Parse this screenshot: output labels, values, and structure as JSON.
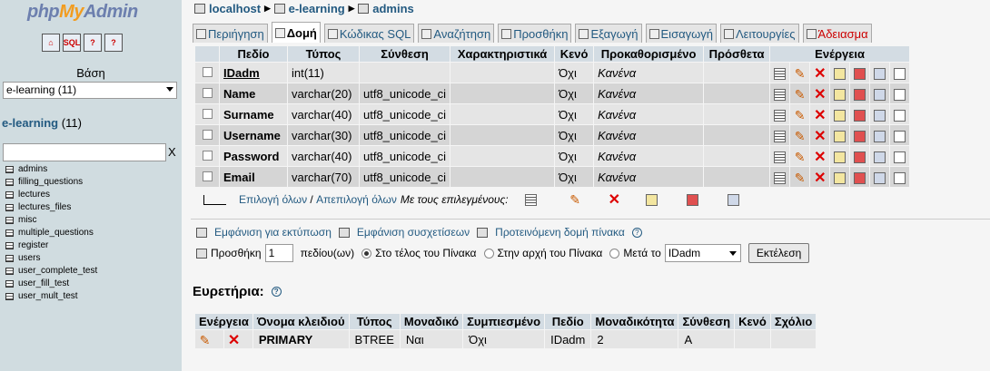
{
  "sidebar": {
    "logo_php": "php",
    "logo_my": "My",
    "logo_admin": "Admin",
    "nav_icons": [
      "home-icon",
      "sql-query-icon",
      "docs-icon",
      "docs-icon-2"
    ],
    "db_label": "Βάση",
    "db_select_value": "e-learning (11)",
    "db_name": "e-learning",
    "db_count": "(11)",
    "filter_clear": "X",
    "tables": [
      "admins",
      "filling_questions",
      "lectures",
      "lectures_files",
      "misc",
      "multiple_questions",
      "register",
      "users",
      "user_complete_test",
      "user_fill_test",
      "user_mult_test"
    ]
  },
  "breadcrumb": {
    "server": "localhost",
    "database": "e-learning",
    "table": "admins"
  },
  "tabs": [
    {
      "label": "Περιήγηση",
      "active": false
    },
    {
      "label": "Δομή",
      "active": true
    },
    {
      "label": "Κώδικας SQL",
      "active": false
    },
    {
      "label": "Αναζήτηση",
      "active": false
    },
    {
      "label": "Προσθήκη",
      "active": false
    },
    {
      "label": "Εξαγωγή",
      "active": false
    },
    {
      "label": "Εισαγωγή",
      "active": false
    },
    {
      "label": "Λειτουργίες",
      "active": false
    },
    {
      "label": "Άδειασμα",
      "active": false
    }
  ],
  "structure": {
    "headers": {
      "field": "Πεδίο",
      "type": "Τύπος",
      "collation": "Σύνθεση",
      "attributes": "Χαρακτηριστικά",
      "null": "Κενό",
      "default": "Προκαθορισμένο",
      "extra": "Πρόσθετα",
      "actions": "Ενέργεια"
    },
    "rows": [
      {
        "field": "IDadm",
        "type": "int(11)",
        "collation": "",
        "attributes": "",
        "null": "Όχι",
        "default": "Κανένα",
        "extra": ""
      },
      {
        "field": "Name",
        "type": "varchar(20)",
        "collation": "utf8_unicode_ci",
        "attributes": "",
        "null": "Όχι",
        "default": "Κανένα",
        "extra": ""
      },
      {
        "field": "Surname",
        "type": "varchar(40)",
        "collation": "utf8_unicode_ci",
        "attributes": "",
        "null": "Όχι",
        "default": "Κανένα",
        "extra": ""
      },
      {
        "field": "Username",
        "type": "varchar(30)",
        "collation": "utf8_unicode_ci",
        "attributes": "",
        "null": "Όχι",
        "default": "Κανένα",
        "extra": ""
      },
      {
        "field": "Password",
        "type": "varchar(40)",
        "collation": "utf8_unicode_ci",
        "attributes": "",
        "null": "Όχι",
        "default": "Κανένα",
        "extra": ""
      },
      {
        "field": "Email",
        "type": "varchar(70)",
        "collation": "utf8_unicode_ci",
        "attributes": "",
        "null": "Όχι",
        "default": "Κανένα",
        "extra": ""
      }
    ]
  },
  "bulk": {
    "check_all": "Επιλογή όλων",
    "separator": " / ",
    "uncheck_all": "Απεπιλογή όλων",
    "with_selected": "Με τους επιλεγμένους:"
  },
  "links": {
    "print_view": "Εμφάνιση για εκτύπωση",
    "relation_view": "Εμφάνιση συσχετίσεων",
    "propose_structure": "Προτεινόμενη δομή πίνακα"
  },
  "add_fields": {
    "prefix": "Προσθήκη",
    "count": "1",
    "suffix": "πεδίου(ων)",
    "at_end": "Στο τέλος του Πίνακα",
    "at_start": "Στην αρχή του Πίνακα",
    "after": "Μετά το",
    "after_field": "IDadm",
    "go_button": "Εκτέλεση"
  },
  "indexes": {
    "title": "Ευρετήρια:",
    "headers": [
      "Ενέργεια",
      "Όνομα κλειδιού",
      "Τύπος",
      "Μοναδικό",
      "Συμπιεσμένο",
      "Πεδίο",
      "Μοναδικότητα",
      "Σύνθεση",
      "Κενό",
      "Σχόλιο"
    ],
    "rows": [
      {
        "keyname": "PRIMARY",
        "type": "BTREE",
        "unique": "Ναι",
        "packed": "Όχι",
        "field": "IDadm",
        "cardinality": "2",
        "collation": "A",
        "null": "",
        "comment": ""
      }
    ]
  }
}
